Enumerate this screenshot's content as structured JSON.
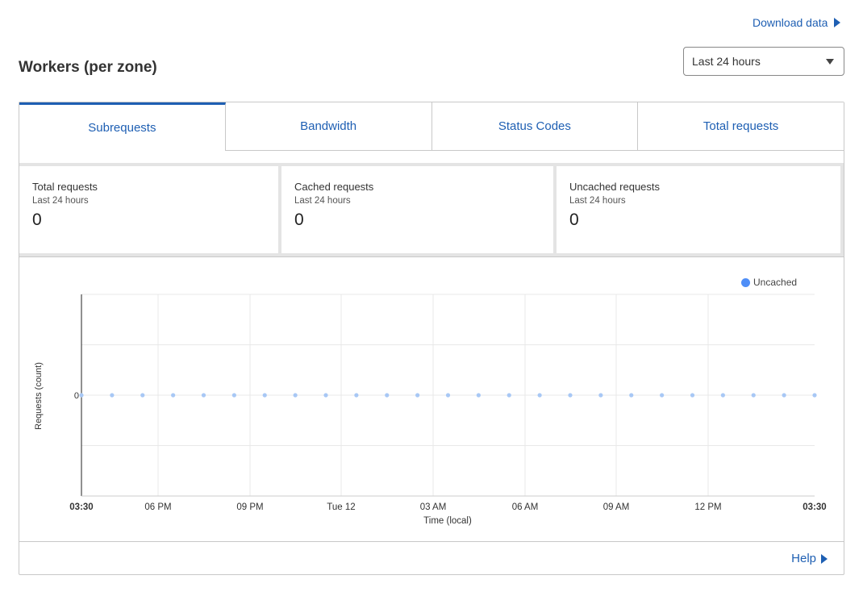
{
  "header": {
    "download_label": "Download data",
    "title": "Workers (per zone)",
    "range_value": "Last 24 hours"
  },
  "tabs": [
    {
      "label": "Subrequests",
      "active": true
    },
    {
      "label": "Bandwidth",
      "active": false
    },
    {
      "label": "Status Codes",
      "active": false
    },
    {
      "label": "Total requests",
      "active": false
    }
  ],
  "stats": [
    {
      "label": "Total requests",
      "sub": "Last 24 hours",
      "value": "0"
    },
    {
      "label": "Cached requests",
      "sub": "Last 24 hours",
      "value": "0"
    },
    {
      "label": "Uncached requests",
      "sub": "Last 24 hours",
      "value": "0"
    }
  ],
  "footer": {
    "help_label": "Help"
  },
  "colors": {
    "accent": "#1e5fb3",
    "series": "#4f8ef7",
    "point": "#a8c8f5"
  },
  "chart_data": {
    "type": "scatter",
    "ylabel": "Requests (count)",
    "xlabel": "Time (local)",
    "y_ticks": [
      "0"
    ],
    "x_tick_labels": [
      "03:30",
      "06 PM",
      "09 PM",
      "Tue 12",
      "03 AM",
      "06 AM",
      "09 AM",
      "12 PM",
      "03:30"
    ],
    "grid": true,
    "legend_position": "top-right",
    "series": [
      {
        "name": "Uncached",
        "values": [
          0,
          0,
          0,
          0,
          0,
          0,
          0,
          0,
          0,
          0,
          0,
          0,
          0,
          0,
          0,
          0,
          0,
          0,
          0,
          0,
          0,
          0,
          0,
          0,
          0
        ]
      }
    ]
  }
}
